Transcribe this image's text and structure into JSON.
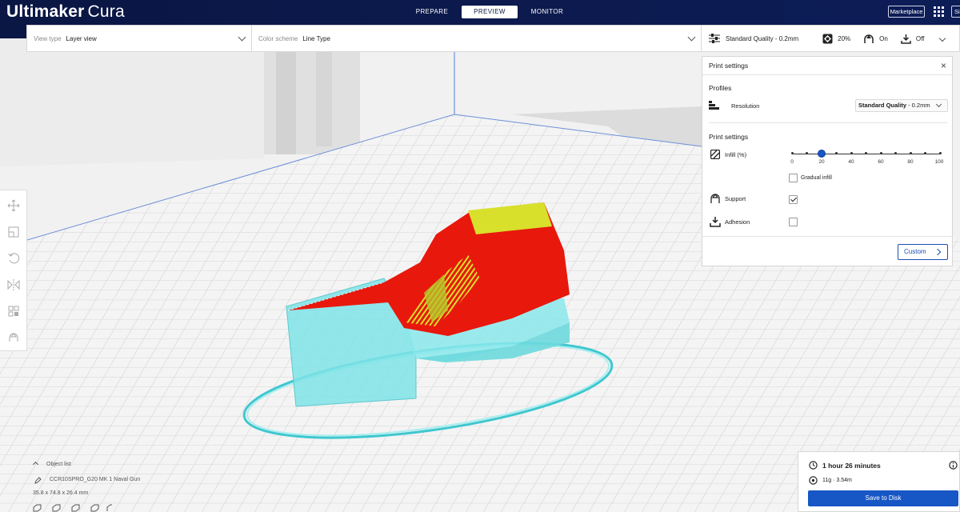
{
  "app": {
    "name_bold": "Ultimaker",
    "name_light": "Cura"
  },
  "stages": [
    {
      "label": "PREPARE",
      "active": false
    },
    {
      "label": "PREVIEW",
      "active": true
    },
    {
      "label": "MONITOR",
      "active": false
    }
  ],
  "header": {
    "marketplace_label": "Marketplace",
    "account_label": "Si"
  },
  "toolbar": {
    "view_type_label": "View type",
    "view_type_value": "Layer view",
    "color_scheme_label": "Color scheme",
    "color_scheme_value": "Line Type"
  },
  "quality_bar": {
    "profile": "Standard Quality - 0.2mm",
    "infill": "20%",
    "support": "On",
    "adhesion": "Off"
  },
  "print_settings": {
    "title": "Print settings",
    "profiles_heading": "Profiles",
    "resolution_label": "Resolution",
    "resolution_value_bold": "Standard Quality",
    "resolution_value_rest": " - 0.2mm",
    "settings_heading": "Print settings",
    "infill_label": "Infill (%)",
    "infill_value": 20,
    "infill_ticks": [
      "0",
      "20",
      "40",
      "60",
      "80",
      "100"
    ],
    "gradual_infill_label": "Gradual infill",
    "gradual_infill_checked": false,
    "support_label": "Support",
    "support_checked": true,
    "adhesion_label": "Adhesion",
    "adhesion_checked": false,
    "custom_button": "Custom"
  },
  "object_list": {
    "toggle_label": "Object list",
    "object_name": "CCR10SPRO_G20 MK 1 Naval Gun",
    "dimensions": "35.8 x 74.8 x 26.4 mm"
  },
  "output": {
    "print_time": "1 hour 26 minutes",
    "material": "11g · 3.54m",
    "save_button": "Save to Disk"
  },
  "colors": {
    "header": "#0b1744",
    "accent": "#1756c5",
    "shell": "#e8180d",
    "infill": "#d8e02b",
    "support": "#7ee3e6"
  }
}
